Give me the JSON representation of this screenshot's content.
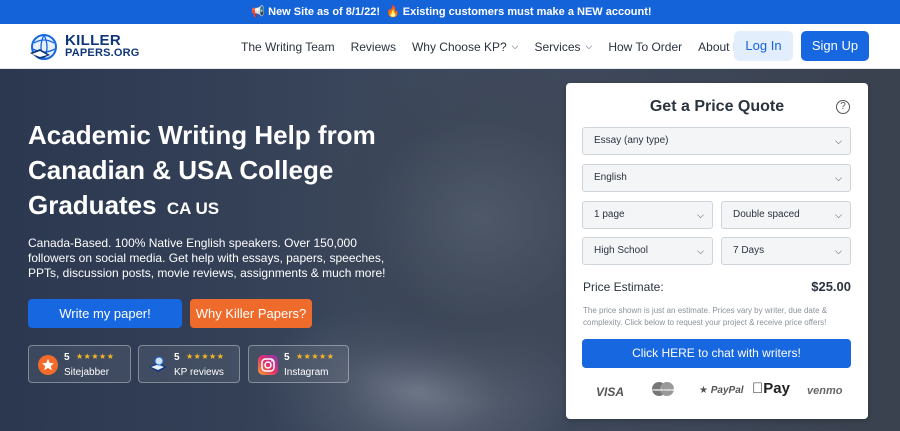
{
  "announcement": {
    "glyph_left": "📢",
    "text_left": "New Site as of 8/1/22!",
    "glyph_right": "🔥",
    "text_right": "Existing customers must make a NEW account!"
  },
  "logo": {
    "line1": "KILLER",
    "line2": "PAPERS.ORG"
  },
  "nav": {
    "items": [
      {
        "label": "The Writing Team",
        "dropdown": false
      },
      {
        "label": "Reviews",
        "dropdown": false
      },
      {
        "label": "Why Choose KP?",
        "dropdown": true
      },
      {
        "label": "Services",
        "dropdown": true
      },
      {
        "label": "How To Order",
        "dropdown": false
      },
      {
        "label": "About KP",
        "dropdown": true
      }
    ],
    "login": "Log In",
    "signup": "Sign Up"
  },
  "hero": {
    "title": "Academic Writing Help from Canadian & USA College Graduates",
    "flags": "CA US",
    "description": "Canada-Based. 100% Native English speakers. Over 150,000 followers on social media. Get help with essays, papers, speeches, PPTs, discussion posts, movie reviews, assignments & much more!",
    "btn_write": "Write my paper!",
    "btn_why": "Why Killer Papers?"
  },
  "reviews": [
    {
      "score": "5",
      "stars": "★★★★★",
      "source": "Sitejabber",
      "icon": "sitejabber-icon"
    },
    {
      "score": "5",
      "stars": "★★★★★",
      "source": "KP reviews",
      "icon": "kp-reviews-icon"
    },
    {
      "score": "5",
      "stars": "★★★★★",
      "source": "Instagram",
      "icon": "instagram-icon"
    }
  ],
  "quote": {
    "title": "Get a Price Quote",
    "help": "?",
    "paper_type": "Essay (any type)",
    "language": "English",
    "pages": "1 page",
    "spacing": "Double spaced",
    "level": "High School",
    "deadline": "7 Days",
    "estimate_label": "Price Estimate:",
    "estimate_value": "$25.00",
    "note": "The price shown is just an estimate. Prices vary by writer, due date & complexity. Click below to request your project & receive price offers!",
    "chat_button": "Click HERE to chat with writers!",
    "payments": [
      "VISA",
      "mastercard",
      "PayPal",
      "Pay",
      "venmo"
    ]
  },
  "colors": {
    "primary": "#1667e0",
    "orange": "#ef6b2b",
    "announce": "#1463d8",
    "star": "#f5b921"
  }
}
